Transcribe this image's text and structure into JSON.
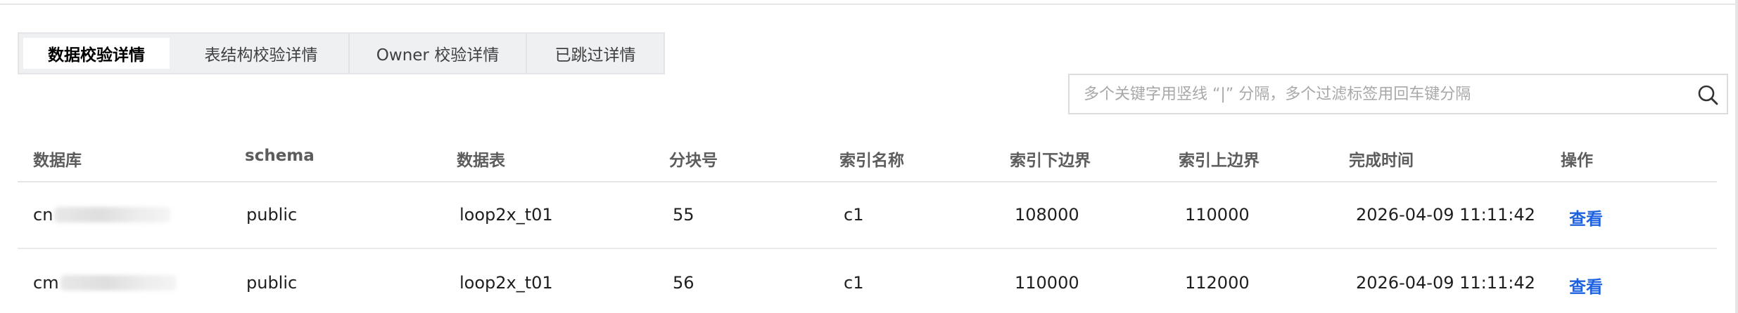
{
  "tabs": [
    {
      "label": "数据校验详情",
      "active": true
    },
    {
      "label": "表结构校验详情",
      "active": false
    },
    {
      "label": "Owner 校验详情",
      "active": false
    },
    {
      "label": "已跳过详情",
      "active": false
    }
  ],
  "search": {
    "placeholder": "多个关键字用竖线 “|” 分隔，多个过滤标签用回车键分隔",
    "value": "",
    "icon": "search-icon"
  },
  "table": {
    "columns": [
      "数据库",
      "schema",
      "数据表",
      "分块号",
      "索引名称",
      "索引下边界",
      "索引上边界",
      "完成时间",
      "操作"
    ],
    "rows": [
      {
        "database": "cn",
        "schema": "public",
        "table": "loop2x_t01",
        "chunk": "55",
        "index_name": "c1",
        "lower": "108000",
        "upper": "110000",
        "finished": "2026-04-09 11:11:42",
        "action": "查看"
      },
      {
        "database": "cm",
        "schema": "public",
        "table": "loop2x_t01",
        "chunk": "56",
        "index_name": "c1",
        "lower": "110000",
        "upper": "112000",
        "finished": "2026-04-09 11:11:42",
        "action": "查看"
      }
    ]
  },
  "colors": {
    "link": "#1f62e0",
    "header_text": "#5c5c5c",
    "tab_bg": "#eef0f2"
  }
}
